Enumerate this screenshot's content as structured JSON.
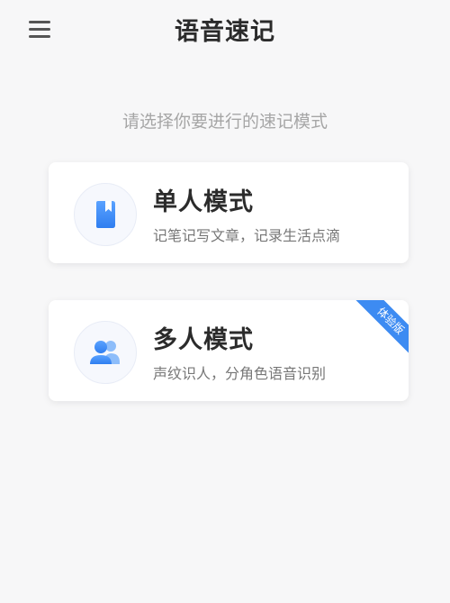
{
  "header": {
    "title": "语音速记",
    "menu_icon": "hamburger-menu-icon"
  },
  "prompt": "请选择你要进行的速记模式",
  "cards": {
    "single": {
      "title": "单人模式",
      "desc": "记笔记写文章，记录生活点滴",
      "icon": "bookmark-icon"
    },
    "multi": {
      "title": "多人模式",
      "desc": "声纹识人，分角色语音识别",
      "icon": "users-icon",
      "badge": "体验版"
    }
  },
  "colors": {
    "accent": "#3d8bf2",
    "background": "#f7f7f8",
    "card": "#ffffff",
    "title_text": "#2b2b2b",
    "muted_text": "#a6a6a6"
  }
}
